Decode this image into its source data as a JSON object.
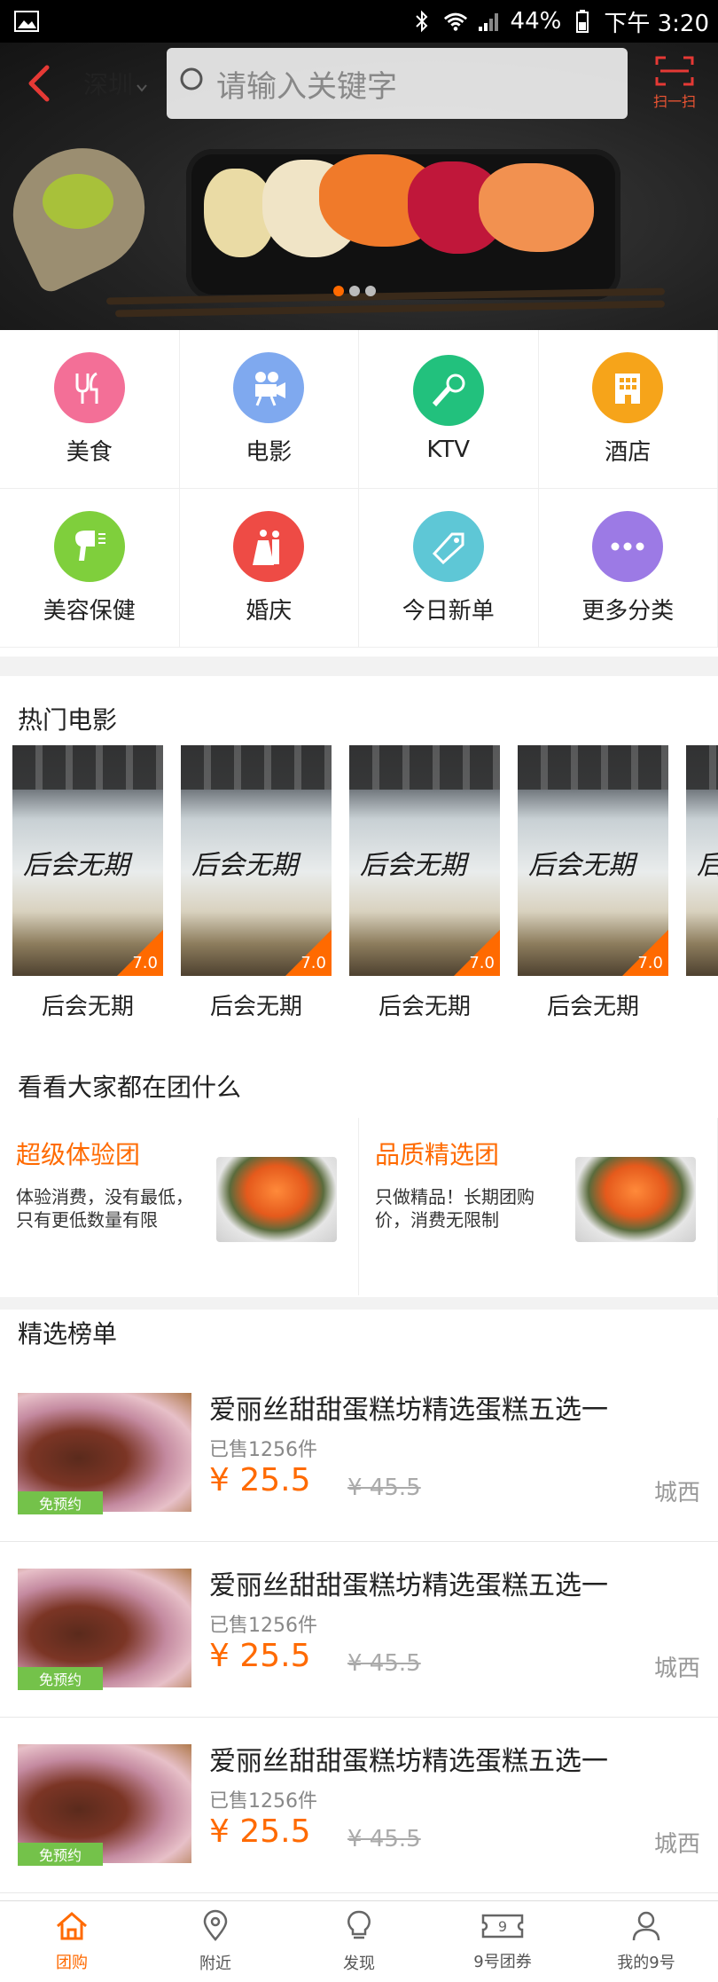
{
  "status_bar": {
    "battery": "44%",
    "time": "下午 3:20"
  },
  "header": {
    "city": "深圳",
    "search_placeholder": "请输入关键字",
    "scan_label": "扫一扫"
  },
  "categories": [
    {
      "label": "美食",
      "color": "#f36f97",
      "icon": "utensils-icon"
    },
    {
      "label": "电影",
      "color": "#7fa9ef",
      "icon": "movie-camera-icon"
    },
    {
      "label": "KTV",
      "color": "#22c17d",
      "icon": "microphone-icon"
    },
    {
      "label": "酒店",
      "color": "#f6a41a",
      "icon": "hotel-icon"
    },
    {
      "label": "美容保健",
      "color": "#7fcf3c",
      "icon": "hair-dryer-icon"
    },
    {
      "label": "婚庆",
      "color": "#ee4b45",
      "icon": "wedding-couple-icon"
    },
    {
      "label": "今日新单",
      "color": "#5ec7d6",
      "icon": "tag-icon"
    },
    {
      "label": "更多分类",
      "color": "#9c7ae5",
      "icon": "more-dots-icon"
    }
  ],
  "movies_section": {
    "title": "热门电影",
    "items": [
      {
        "name": "后会无期",
        "poster_text": "后会无期",
        "score": "7.0"
      },
      {
        "name": "后会无期",
        "poster_text": "后会无期",
        "score": "7.0"
      },
      {
        "name": "后会无期",
        "poster_text": "后会无期",
        "score": "7.0"
      },
      {
        "name": "后会无期",
        "poster_text": "后会无期",
        "score": "7.0"
      },
      {
        "name": "后",
        "poster_text": "后",
        "score": ""
      }
    ]
  },
  "group_section": {
    "title": "看看大家都在团什么",
    "cards": [
      {
        "title": "超级体验团",
        "desc": "体验消费，没有最低，只有更低数量有限"
      },
      {
        "title": "品质精选团",
        "desc": "只做精品！长期团购价，消费无限制"
      }
    ]
  },
  "ranking_section": {
    "title": "精选榜单",
    "deals": [
      {
        "title": "爱丽丝甜甜蛋糕坊精选蛋糕五选一",
        "sold": "已售1256件",
        "price": "¥ 25.5",
        "original_price": "¥ 45.5",
        "area": "城西",
        "badge": "免预约"
      },
      {
        "title": "爱丽丝甜甜蛋糕坊精选蛋糕五选一",
        "sold": "已售1256件",
        "price": "¥ 25.5",
        "original_price": "¥ 45.5",
        "area": "城西",
        "badge": "免预约"
      },
      {
        "title": "爱丽丝甜甜蛋糕坊精选蛋糕五选一",
        "sold": "已售1256件",
        "price": "¥ 25.5",
        "original_price": "¥ 45.5",
        "area": "城西",
        "badge": "免预约"
      }
    ]
  },
  "tabs": [
    {
      "label": "团购",
      "icon": "home-icon",
      "active": true
    },
    {
      "label": "附近",
      "icon": "location-pin-icon",
      "active": false
    },
    {
      "label": "发现",
      "icon": "lightbulb-icon",
      "active": false
    },
    {
      "label": "9号团券",
      "icon": "ticket-icon",
      "active": false
    },
    {
      "label": "我的9号",
      "icon": "user-icon",
      "active": false
    }
  ],
  "colors": {
    "accent": "#ff6a00"
  }
}
